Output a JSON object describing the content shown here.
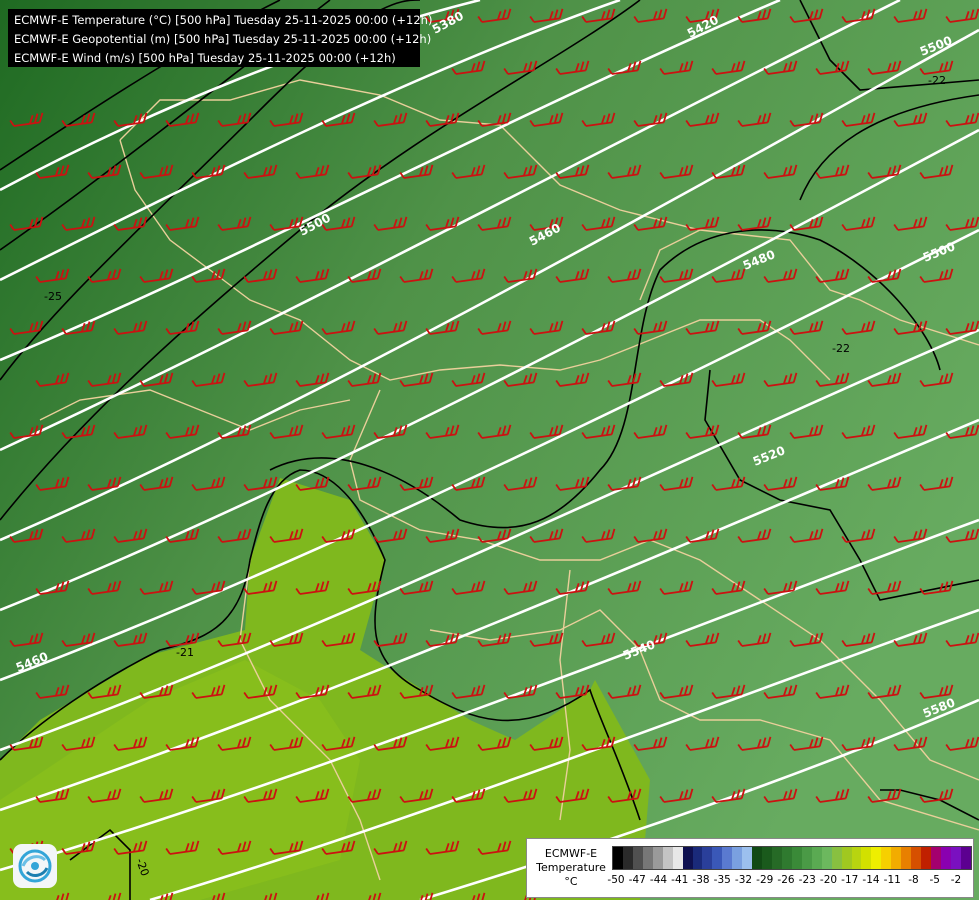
{
  "header": {
    "lines": [
      "ECMWF-E Temperature (°C) [500 hPa] Tuesday 25-11-2025 00:00 (+12h)",
      "ECMWF-E Geopotential (m) [500 hPa] Tuesday 25-11-2025 00:00 (+12h)",
      "ECMWF-E Wind (m/s) [500 hPa] Tuesday 25-11-2025 00:00 (+12h)"
    ]
  },
  "legend": {
    "line1": "ECMWF-E",
    "line2": "Temperature",
    "line3": "°C",
    "ticks": [
      "-50",
      "-47",
      "-44",
      "-41",
      "-38",
      "-35",
      "-32",
      "-29",
      "-26",
      "-23",
      "-20",
      "-17",
      "-14",
      "-11",
      "-8",
      "-5",
      "-2"
    ],
    "colors": [
      "#000000",
      "#2a2a2a",
      "#505050",
      "#777777",
      "#9a9a9a",
      "#c4c4c4",
      "#e8e8e8",
      "#0e1050",
      "#1a2a7a",
      "#2a3f9a",
      "#3a58b8",
      "#5a7ad0",
      "#7aa0e0",
      "#9cc0ee",
      "#114a14",
      "#1a5a1c",
      "#266a26",
      "#2f7a2f",
      "#3a8a38",
      "#4a9a46",
      "#5aaa52",
      "#6cb85e",
      "#88c040",
      "#a0c820",
      "#b8d410",
      "#d2e000",
      "#eeee00",
      "#f6d000",
      "#f2ac00",
      "#e88000",
      "#d65000",
      "#c02000",
      "#a4006e",
      "#8a00b0",
      "#7a10c0",
      "#5c0090"
    ],
    "accent_colors": {
      "barb": "#cc1111",
      "geopotential": "#ffffff",
      "isotherm": "#000000",
      "border": "#e9cf9a"
    }
  },
  "map": {
    "geopotential_labels": [
      "5380",
      "5420",
      "5460",
      "5500",
      "5500",
      "5520",
      "5540",
      "5460",
      "5480",
      "5580"
    ],
    "isotherm_labels": [
      "-22",
      "-25",
      "-21",
      "-22",
      "-20"
    ],
    "geopotential_values": [
      5380,
      5420,
      5460,
      5480,
      5500,
      5520,
      5540,
      5580
    ],
    "temperature_levels_visible": [
      -25,
      -22,
      -21,
      -20
    ]
  }
}
